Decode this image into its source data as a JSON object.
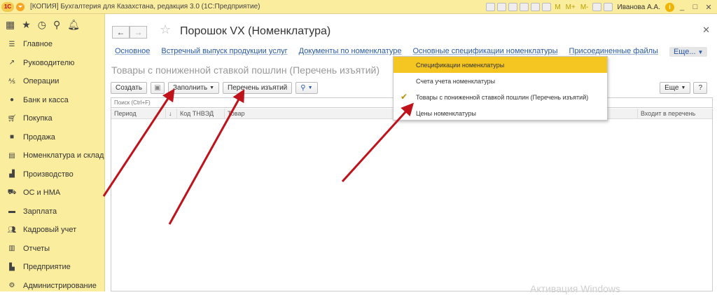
{
  "window": {
    "app_title": "[КОПИЯ] Бухгалтерия для Казахстана, редакция 3.0  (1С:Предприятие)",
    "toolbar_letters": [
      "M",
      "M+",
      "M-"
    ],
    "user": "Иванова А.А."
  },
  "sidebar": {
    "items": [
      {
        "label": "Главное",
        "icon": "menu-icon"
      },
      {
        "label": "Руководителю",
        "icon": "trend-icon"
      },
      {
        "label": "Операции",
        "icon": "operations-icon"
      },
      {
        "label": "Банк и касса",
        "icon": "bank-icon"
      },
      {
        "label": "Покупка",
        "icon": "cart-icon"
      },
      {
        "label": "Продажа",
        "icon": "bag-icon"
      },
      {
        "label": "Номенклатура и склад",
        "icon": "warehouse-icon"
      },
      {
        "label": "Производство",
        "icon": "factory-icon"
      },
      {
        "label": "ОС и НМА",
        "icon": "truck-icon"
      },
      {
        "label": "Зарплата",
        "icon": "salary-icon"
      },
      {
        "label": "Кадровый учет",
        "icon": "people-icon"
      },
      {
        "label": "Отчеты",
        "icon": "chart-icon"
      },
      {
        "label": "Предприятие",
        "icon": "enterprise-icon"
      },
      {
        "label": "Администрирование",
        "icon": "gear-icon"
      }
    ]
  },
  "document": {
    "title": "Порошок VX (Номенклатура)",
    "links": [
      "Основное",
      "Встречный выпуск продукции услуг",
      "Документы по номенклатуре",
      "Основные спецификации номенклатуры",
      "Присоединенные файлы"
    ],
    "more_label": "Еще...",
    "form_title": "Товары с пониженной ставкой пошлин (Перечень изъятий)"
  },
  "toolbar": {
    "create": "Создать",
    "fill": "Заполнить",
    "exemptions_list": "Перечень изъятий",
    "more": "Еще",
    "help": "?"
  },
  "search": {
    "placeholder": "Поиск (Ctrl+F)"
  },
  "grid": {
    "columns": [
      "Период",
      "↓",
      "Код ТНВЭД",
      "Товар",
      "Входит в перечень"
    ]
  },
  "dropdown": {
    "items": [
      {
        "label": "Спецификации номенклатуры",
        "active": true,
        "checked": false
      },
      {
        "label": "Счета учета номенклатуры",
        "active": false,
        "checked": false
      },
      {
        "label": "Товары с пониженной ставкой пошлин (Перечень изъятий)",
        "active": false,
        "checked": true
      },
      {
        "label": "Цены номенклатуры",
        "active": false,
        "checked": false
      }
    ]
  },
  "watermark": "Активация Windows",
  "colors": {
    "sidebar_bg": "#fbed9e",
    "link": "#2a5aa5",
    "active_item": "#f5c621",
    "annotation_arrow": "#c0121a"
  }
}
